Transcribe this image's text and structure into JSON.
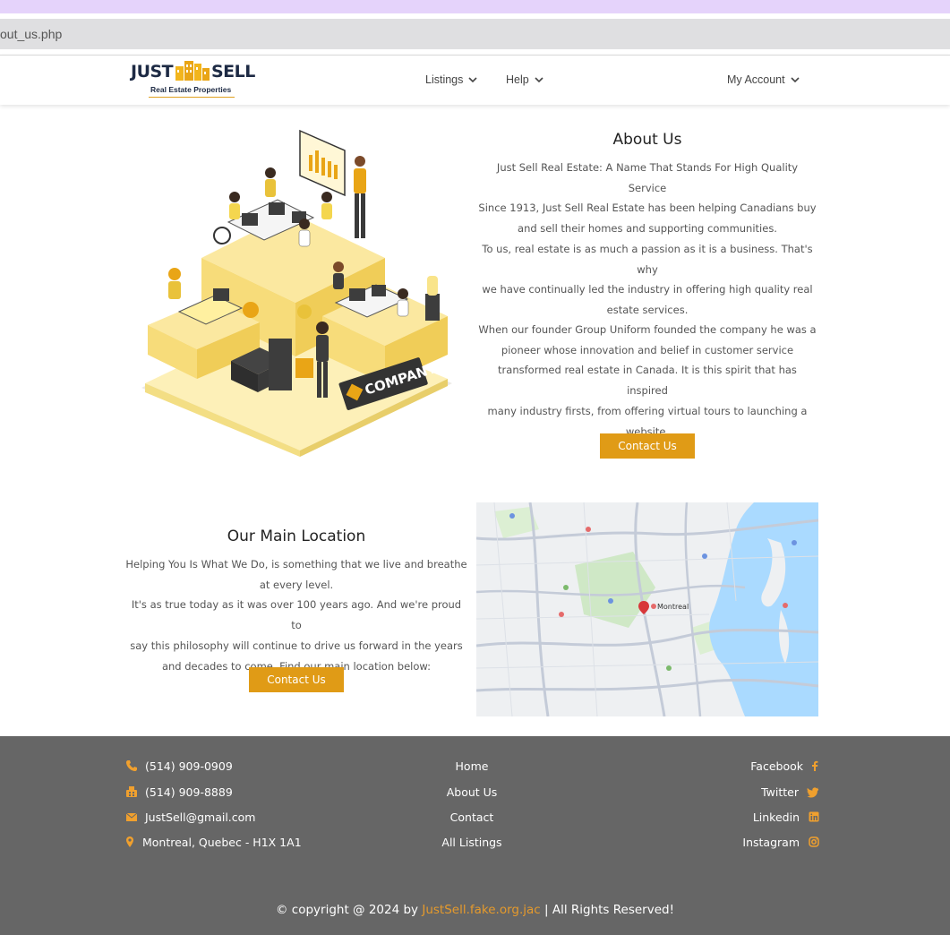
{
  "browser": {
    "url": "out_us.php"
  },
  "header": {
    "logo": {
      "word1": "JUST",
      "word2": "SELL",
      "tagline": "Real Estate Properties"
    },
    "nav": [
      {
        "label": "Listings"
      },
      {
        "label": "Help"
      }
    ],
    "account": {
      "label": "My Account"
    }
  },
  "illustration": {
    "sign_text": "COMPANY"
  },
  "about": {
    "title": "About Us",
    "para1_lines": [
      "Just Sell Real Estate: A Name That Stands For High Quality Service",
      "Since 1913, Just Sell Real Estate has been helping Canadians buy",
      "and sell their homes and supporting communities."
    ],
    "para2_lines": [
      "To us, real estate is as much a passion as it is a business. That's why",
      "we have continually led the industry in offering high quality real",
      "estate services."
    ],
    "para3_lines": [
      "When our founder Group Uniform founded the company he was a",
      "pioneer whose innovation and belief in customer service",
      "transformed real estate in Canada. It is this spirit that has inspired",
      "many industry firsts, from offering virtual tours to launching a",
      "website."
    ],
    "button": "Contact Us"
  },
  "location": {
    "title": "Our Main Location",
    "lines": [
      "Helping You Is What We Do, is something that we live and breathe",
      "at every level.",
      "It's as true today as it was over 100 years ago. And we're proud to",
      "say this philosophy will continue to drive us forward in the years",
      "and decades to come. Find our main location below:"
    ],
    "button": "Contact Us",
    "map_label": "Montreal"
  },
  "footer": {
    "contacts": [
      {
        "icon": "phone-icon",
        "text": "(514) 909-0909"
      },
      {
        "icon": "fax-icon",
        "text": "(514) 909-8889"
      },
      {
        "icon": "envelope-icon",
        "text": "JustSell@gmail.com"
      },
      {
        "icon": "map-marker-icon",
        "text": "Montreal, Quebec - H1X 1A1"
      }
    ],
    "links": [
      {
        "label": "Home"
      },
      {
        "label": "About Us"
      },
      {
        "label": "Contact"
      },
      {
        "label": "All Listings"
      }
    ],
    "social": [
      {
        "label": "Facebook",
        "icon": "facebook-icon"
      },
      {
        "label": "Twitter",
        "icon": "twitter-icon"
      },
      {
        "label": "Linkedin",
        "icon": "linkedin-icon"
      },
      {
        "label": "Instagram",
        "icon": "instagram-icon"
      }
    ],
    "copyright": {
      "prefix": "© copyright @ 2024 by ",
      "link": "JustSell.fake.org.jac",
      "suffix": " | All Rights Reserved!"
    }
  },
  "colors": {
    "accent": "#e09b16",
    "footer_bg": "#666666",
    "brand_navy": "#1d2a44",
    "browser_tab": "#e5d3fb"
  }
}
